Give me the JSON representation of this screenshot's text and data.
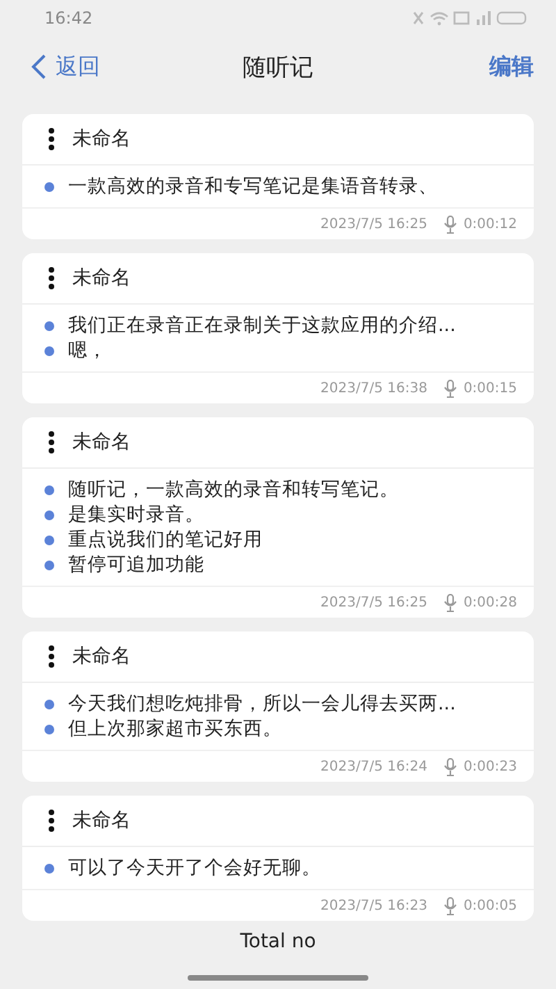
{
  "status_bar": {
    "time": "16:42"
  },
  "nav": {
    "back": "返回",
    "title": "随听记",
    "action": "编辑"
  },
  "notes": [
    {
      "title": "未命名",
      "lines": [
        "一款高效的录音和专写笔记是集语音转录、"
      ],
      "date": "2023/7/5 16:25",
      "duration": "0:00:12"
    },
    {
      "title": "未命名",
      "lines": [
        "我们正在录音正在录制关于这款应用的介绍...",
        "嗯，"
      ],
      "date": "2023/7/5 16:38",
      "duration": "0:00:15"
    },
    {
      "title": "未命名",
      "lines": [
        "随听记，一款高效的录音和转写笔记。",
        "是集实时录音。",
        "重点说我们的笔记好用",
        "暂停可追加功能"
      ],
      "date": "2023/7/5 16:25",
      "duration": "0:00:28"
    },
    {
      "title": "未命名",
      "lines": [
        "今天我们想吃炖排骨，所以一会儿得去买两...",
        "但上次那家超市买东西。"
      ],
      "date": "2023/7/5 16:24",
      "duration": "0:00:23"
    },
    {
      "title": "未命名",
      "lines": [
        "可以了今天开了个会好无聊。"
      ],
      "date": "2023/7/5 16:23",
      "duration": "0:00:05"
    }
  ],
  "footer": "Total no"
}
